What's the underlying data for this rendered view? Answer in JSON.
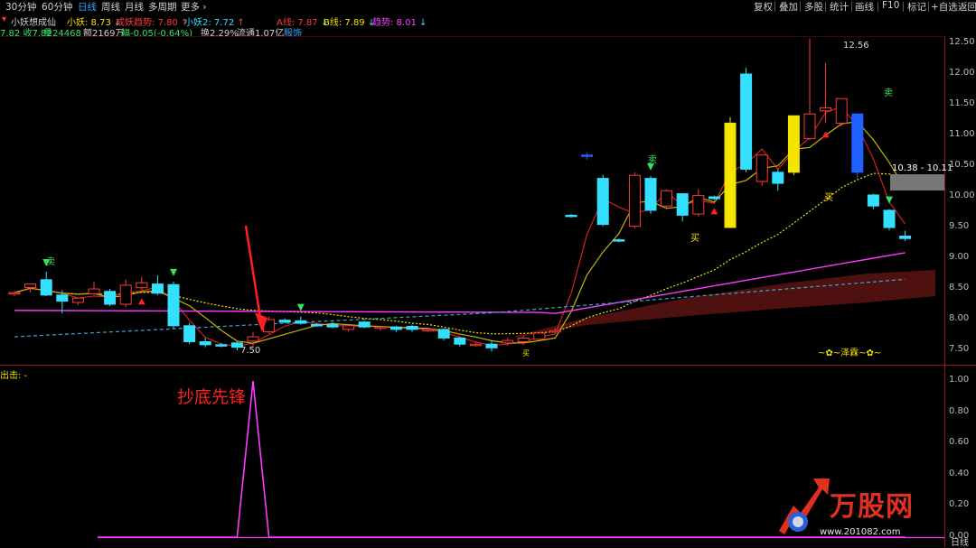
{
  "toolbar": {
    "tabs": [
      {
        "label": "30分钟",
        "active": false
      },
      {
        "label": "60分钟",
        "active": false
      },
      {
        "label": "日线",
        "active": true
      },
      {
        "label": "周线",
        "active": false
      },
      {
        "label": "月线",
        "active": false
      },
      {
        "label": "多周期",
        "active": false
      },
      {
        "label": "更多",
        "active": false,
        "icon": "chevron-right-icon"
      }
    ],
    "right_buttons": [
      "复权",
      "叠加",
      "多股",
      "统计",
      "画线",
      "F10",
      "标记",
      "+自选",
      "返回"
    ]
  },
  "info_line1": {
    "indicator_name": "小妖想成仙",
    "items": [
      {
        "label": "小妖: 8.73",
        "arrow": "down",
        "color": "#f5e400"
      },
      {
        "label": "成妖趋势: 7.80",
        "arrow": "up",
        "color": "#ff3b3b"
      },
      {
        "label": "小妖2: 7.72",
        "arrow": "up",
        "color": "#34e0ff"
      },
      {
        "label": "A线: 7.87",
        "arrow": "down",
        "color": "#ff3b3b"
      },
      {
        "label": "B线: 7.89",
        "arrow": "down",
        "color": "#f5e400"
      },
      {
        "label": "趋势: 8.01",
        "arrow": "down",
        "color": "#ff3bff"
      }
    ]
  },
  "info_line2": {
    "items": [
      {
        "text": "7.82 收7.82",
        "color": "#36e060"
      },
      {
        "text": "量24468",
        "color": "#36e060"
      },
      {
        "text": "额2169万",
        "color": "#d0d0d0"
      },
      {
        "text": "幅-0.05(-0.64%)",
        "color": "#36e060"
      },
      {
        "text": "换2.29%",
        "color": "#d0d0d0"
      },
      {
        "text": "流通1.07亿",
        "color": "#d0d0d0"
      },
      {
        "text": "服饰",
        "color": "#34a4ff"
      }
    ]
  },
  "chart_data": [
    {
      "type": "candlestick",
      "y_ticks": [
        12.5,
        12.0,
        11.5,
        11.0,
        10.5,
        10.0,
        9.5,
        9.0,
        8.5,
        8.0,
        7.5
      ],
      "ylim": [
        7.25,
        12.8
      ],
      "annotations": {
        "high_label": "12.56",
        "low_label": "7.50",
        "range_box": "10.38 - 10.11",
        "sell_signals": [
          "卖",
          "卖",
          "卖"
        ],
        "buy_signals": [
          "买",
          "买",
          "买"
        ],
        "watermark_text": "~✿~泽霖~✿~"
      },
      "candles": [
        {
          "o": 8.44,
          "h": 8.46,
          "c": 8.44,
          "l": 8.38
        },
        {
          "o": 8.52,
          "h": 8.55,
          "c": 8.58,
          "l": 8.44
        },
        {
          "o": 8.65,
          "h": 8.78,
          "c": 8.4,
          "l": 8.38
        },
        {
          "o": 8.4,
          "h": 8.48,
          "c": 8.3,
          "l": 8.1
        },
        {
          "o": 8.28,
          "h": 8.3,
          "c": 8.35,
          "l": 8.24
        },
        {
          "o": 8.42,
          "h": 8.62,
          "c": 8.5,
          "l": 8.4
        },
        {
          "o": 8.46,
          "h": 8.5,
          "c": 8.25,
          "l": 8.22
        },
        {
          "o": 8.25,
          "h": 8.65,
          "c": 8.56,
          "l": 8.2
        },
        {
          "o": 8.52,
          "h": 8.7,
          "c": 8.6,
          "l": 8.48
        },
        {
          "o": 8.58,
          "h": 8.72,
          "c": 8.43,
          "l": 8.4
        },
        {
          "o": 8.57,
          "h": 8.62,
          "c": 7.9,
          "l": 7.86
        },
        {
          "o": 7.9,
          "h": 7.95,
          "c": 7.64,
          "l": 7.6
        },
        {
          "o": 7.64,
          "h": 7.7,
          "c": 7.59,
          "l": 7.55
        },
        {
          "o": 7.59,
          "h": 7.62,
          "c": 7.57,
          "l": 7.55
        },
        {
          "o": 7.62,
          "h": 7.65,
          "c": 7.55,
          "l": 7.5
        },
        {
          "o": 7.65,
          "h": 7.8,
          "c": 7.72,
          "l": 7.55
        },
        {
          "o": 7.8,
          "h": 8.05,
          "c": 8.0,
          "l": 7.78
        },
        {
          "o": 7.99,
          "h": 8.02,
          "c": 7.96,
          "l": 7.94
        },
        {
          "o": 7.98,
          "h": 8.05,
          "c": 7.94,
          "l": 7.92
        },
        {
          "o": 7.92,
          "h": 7.95,
          "c": 7.9,
          "l": 7.88
        },
        {
          "o": 7.92,
          "h": 7.96,
          "c": 7.88,
          "l": 7.86
        },
        {
          "o": 7.84,
          "h": 7.88,
          "c": 7.9,
          "l": 7.8
        },
        {
          "o": 7.96,
          "h": 7.98,
          "c": 7.88,
          "l": 7.86
        },
        {
          "o": 7.86,
          "h": 7.88,
          "c": 7.88,
          "l": 7.82
        },
        {
          "o": 7.88,
          "h": 7.9,
          "c": 7.84,
          "l": 7.8
        },
        {
          "o": 7.89,
          "h": 7.92,
          "c": 7.84,
          "l": 7.8
        },
        {
          "o": 7.82,
          "h": 7.84,
          "c": 7.84,
          "l": 7.8
        },
        {
          "o": 7.84,
          "h": 7.86,
          "c": 7.7,
          "l": 7.66
        },
        {
          "o": 7.7,
          "h": 7.72,
          "c": 7.6,
          "l": 7.56
        },
        {
          "o": 7.6,
          "h": 7.64,
          "c": 7.6,
          "l": 7.56
        },
        {
          "o": 7.6,
          "h": 7.66,
          "c": 7.54,
          "l": 7.48
        },
        {
          "o": 7.62,
          "h": 7.7,
          "c": 7.66,
          "l": 7.58
        },
        {
          "o": 7.64,
          "h": 7.74,
          "c": 7.7,
          "l": 7.58
        },
        {
          "o": 7.68,
          "h": 7.8,
          "c": 7.78,
          "l": 7.66
        },
        {
          "o": 7.8,
          "h": 7.86,
          "c": 7.82,
          "l": 7.78
        },
        {
          "o": 9.7,
          "h": 9.72,
          "c": 9.68,
          "l": 9.66
        },
        {
          "o": 10.68,
          "h": 10.72,
          "c": 10.67,
          "l": 10.6
        },
        {
          "o": 10.3,
          "h": 10.36,
          "c": 9.55,
          "l": 9.52
        },
        {
          "o": 9.3,
          "h": 9.32,
          "c": 9.28,
          "l": 9.26
        },
        {
          "o": 9.52,
          "h": 10.4,
          "c": 10.35,
          "l": 9.48
        },
        {
          "o": 10.3,
          "h": 10.34,
          "c": 9.78,
          "l": 9.72
        },
        {
          "o": 9.85,
          "h": 10.12,
          "c": 10.1,
          "l": 9.8
        },
        {
          "o": 10.05,
          "h": 10.06,
          "c": 9.7,
          "l": 9.6
        },
        {
          "o": 9.72,
          "h": 10.12,
          "c": 10.02,
          "l": 9.68
        },
        {
          "o": 10.0,
          "h": 10.02,
          "c": 9.97,
          "l": 9.95
        },
        {
          "o": 9.5,
          "h": 11.3,
          "c": 11.2,
          "l": 9.5
        },
        {
          "o": 12.0,
          "h": 12.1,
          "c": 10.45,
          "l": 10.4
        },
        {
          "o": 10.25,
          "h": 10.68,
          "c": 10.68,
          "l": 10.18
        },
        {
          "o": 10.4,
          "h": 10.45,
          "c": 10.22,
          "l": 10.1
        },
        {
          "o": 10.4,
          "h": 11.25,
          "c": 11.32,
          "l": 10.35
        },
        {
          "o": 10.95,
          "h": 12.58,
          "c": 11.35,
          "l": 10.92
        },
        {
          "o": 11.4,
          "h": 12.18,
          "c": 11.45,
          "l": 11.2
        },
        {
          "o": 11.2,
          "h": 11.5,
          "c": 11.6,
          "l": 11.15
        },
        {
          "o": 11.35,
          "h": 11.35,
          "c": 10.4,
          "l": 10.3
        },
        {
          "o": 10.03,
          "h": 10.05,
          "c": 9.85,
          "l": 9.8
        },
        {
          "o": 9.78,
          "h": 9.8,
          "c": 9.5,
          "l": 9.45
        },
        {
          "o": 9.36,
          "h": 9.45,
          "c": 9.32,
          "l": 9.28
        }
      ]
    },
    {
      "type": "line",
      "series_label": "出击: -",
      "annotation": "抄底先锋",
      "y_ticks": [
        1.0,
        0.8,
        0.6,
        0.4,
        0.2,
        0.0
      ],
      "ylim": [
        -0.05,
        1.05
      ],
      "values": [
        0,
        0,
        0,
        0,
        0,
        0,
        0,
        0,
        0,
        0,
        0,
        0,
        0,
        0,
        0,
        1,
        0,
        0,
        0,
        0,
        0,
        0,
        0,
        0,
        0,
        0,
        0,
        0,
        0,
        0,
        0,
        0,
        0,
        0,
        0,
        0,
        0,
        0,
        0,
        0,
        0,
        0,
        0,
        0,
        0,
        0,
        0,
        0,
        0,
        0,
        0,
        0,
        0,
        0,
        0,
        0,
        0
      ]
    }
  ],
  "logo": {
    "text": "万股网",
    "url_text": "www.201082.com"
  },
  "bottom_right": "日线",
  "colors": {
    "up": "#ff3b3b",
    "down": "#34e0ff",
    "yellow": "#f5e400",
    "magenta": "#ff3bff",
    "blue_candle": "#2060ff",
    "green": "#36e060"
  }
}
